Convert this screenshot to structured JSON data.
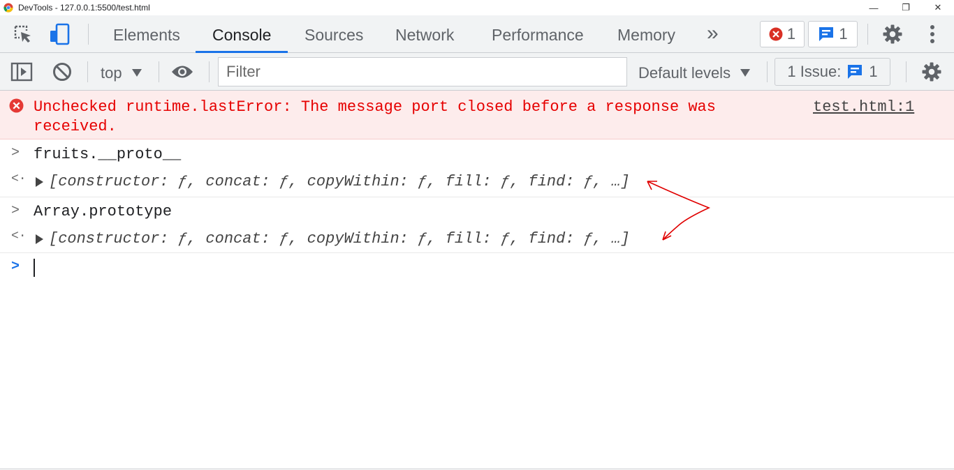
{
  "window": {
    "title": "DevTools - 127.0.0.1:5500/test.html",
    "minimize": "—",
    "restore": "❐",
    "close": "✕"
  },
  "tabs": [
    {
      "label": "Elements",
      "active": false
    },
    {
      "label": "Console",
      "active": true
    },
    {
      "label": "Sources",
      "active": false
    },
    {
      "label": "Network",
      "active": false
    },
    {
      "label": "Performance",
      "active": false
    },
    {
      "label": "Memory",
      "active": false
    }
  ],
  "more_tabs_glyph": "»",
  "counters": {
    "errors": "1",
    "messages": "1"
  },
  "console_toolbar": {
    "context": "top",
    "filter_placeholder": "Filter",
    "levels": "Default levels",
    "issues_label": "1 Issue:",
    "issues_count": "1"
  },
  "colors": {
    "accent": "#1a73e8",
    "error_text": "#e60000",
    "error_bg": "#fdecec",
    "annotation": "#e00000"
  },
  "console": {
    "error": {
      "message": "Unchecked runtime.lastError: The message port closed before a response was received.",
      "source": "test.html:1"
    },
    "entries": [
      {
        "input": "fruits.__proto__",
        "output": "[constructor: ƒ, concat: ƒ, copyWithin: ƒ, fill: ƒ, find: ƒ, …]"
      },
      {
        "input": "Array.prototype",
        "output": "[constructor: ƒ, concat: ƒ, copyWithin: ƒ, fill: ƒ, find: ƒ, …]"
      }
    ]
  }
}
